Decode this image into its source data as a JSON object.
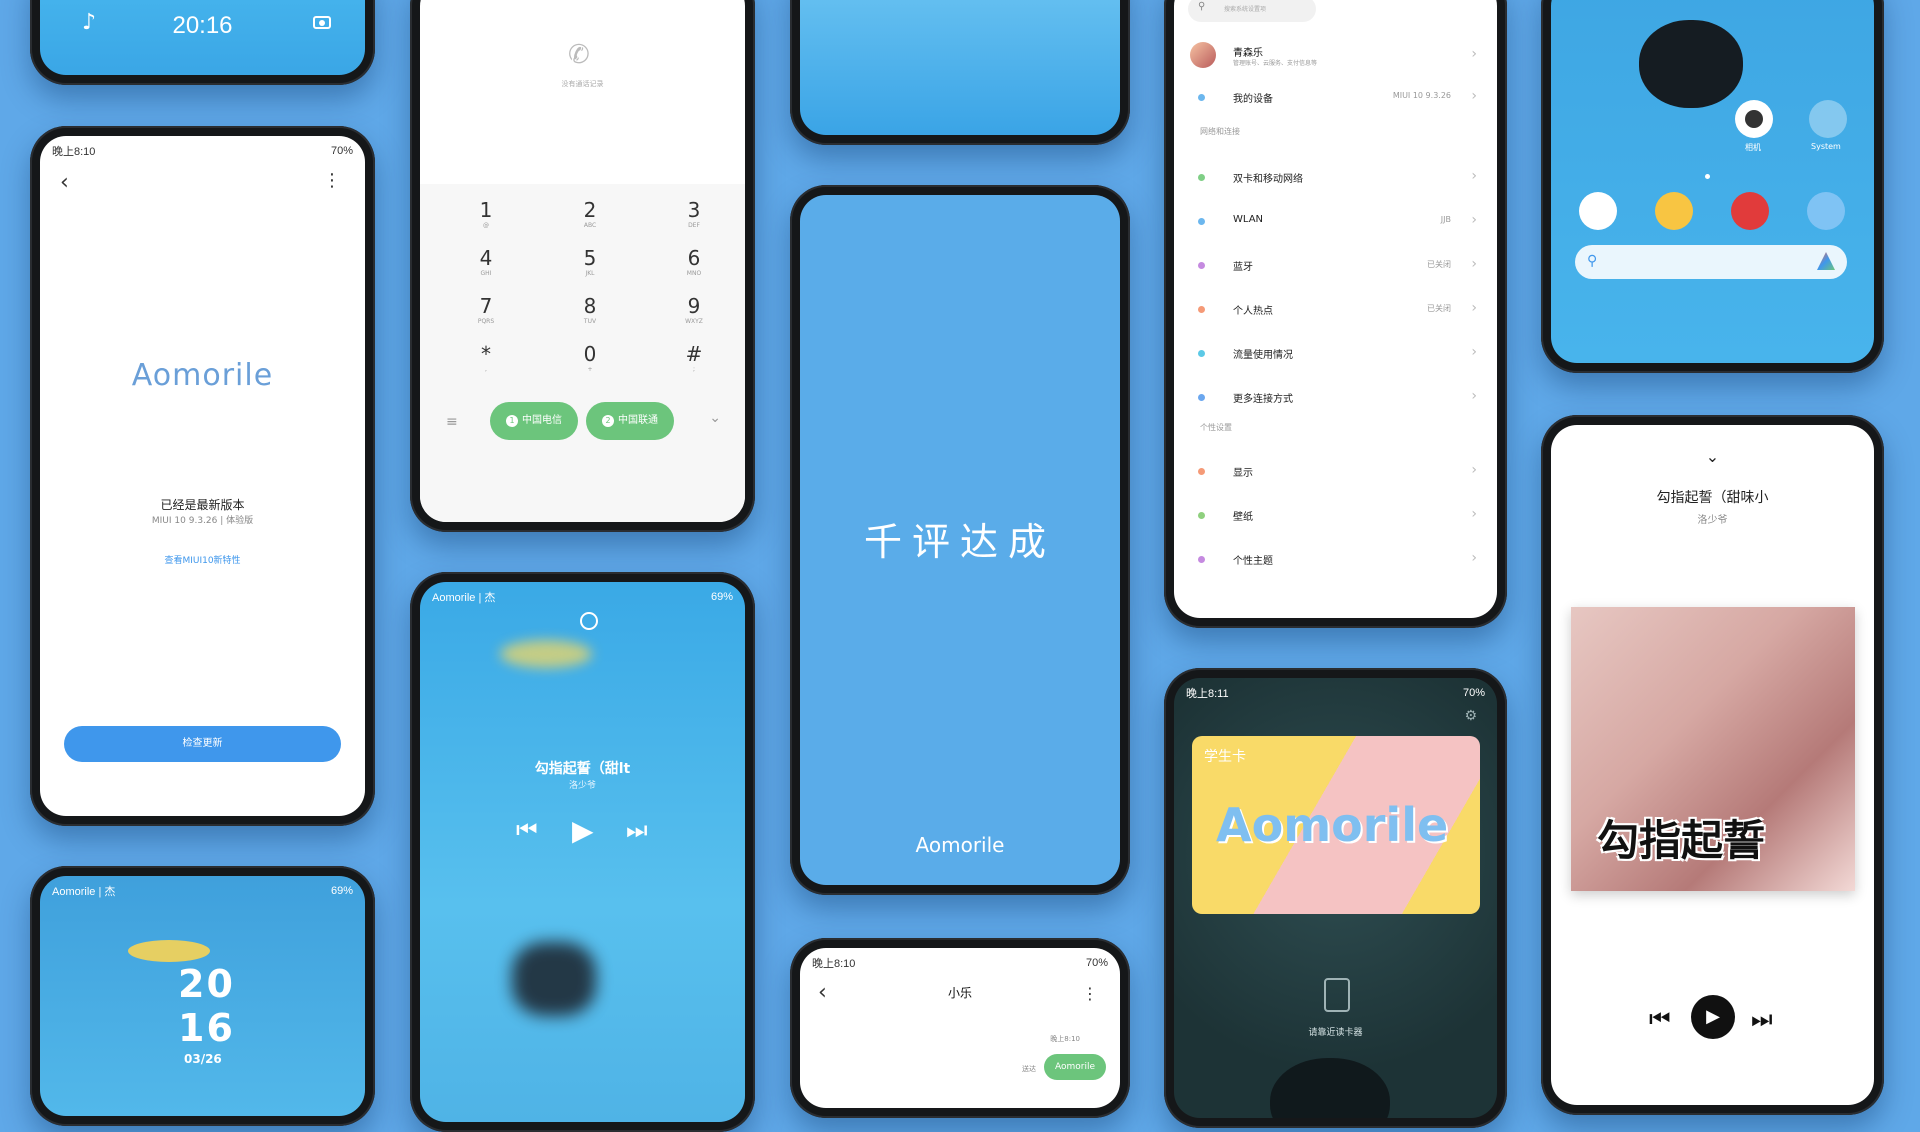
{
  "colors": {
    "background": "#5fa8e8",
    "accent": "#3f97ec",
    "dial_green": "#6cc57c"
  },
  "p1": {
    "time": "20:16",
    "music_icon": "music-note-icon",
    "camera_icon": "camera-icon"
  },
  "p2": {
    "status_time": "晚上8:10",
    "battery": "70%",
    "logo": "Aomorile",
    "title": "已经是最新版本",
    "version": "MIUI 10 9.3.26 | 体验版",
    "link": "查看MIUI10新特性",
    "button": "检查更新"
  },
  "p3": {
    "carrier": "Aomorile | 杰",
    "battery": "69%",
    "date_a": "20",
    "date_b": "16",
    "date": "03/26"
  },
  "p4": {
    "empty_text": "没有通话记录",
    "keys": [
      {
        "d": "1",
        "l": "@"
      },
      {
        "d": "2",
        "l": "ABC"
      },
      {
        "d": "3",
        "l": "DEF"
      },
      {
        "d": "4",
        "l": "GHI"
      },
      {
        "d": "5",
        "l": "JKL"
      },
      {
        "d": "6",
        "l": "MNO"
      },
      {
        "d": "7",
        "l": "PQRS"
      },
      {
        "d": "8",
        "l": "TUV"
      },
      {
        "d": "9",
        "l": "WXYZ"
      },
      {
        "d": "*",
        "l": ","
      },
      {
        "d": "0",
        "l": "+"
      },
      {
        "d": "#",
        "l": ";"
      }
    ],
    "sim1": "中国电信",
    "sim2": "中国联通",
    "sim1_num": "1",
    "sim2_num": "2"
  },
  "p5": {
    "carrier": "Aomorile | 杰",
    "battery": "69%",
    "song": "勾指起誓（甜lt",
    "artist": "洛少爷"
  },
  "p7": {
    "slogan": "千评达成",
    "logo": "Aomorile"
  },
  "p8": {
    "status_time": "晚上8:10",
    "battery": "70%",
    "title": "小乐",
    "msg_time": "晚上8:10",
    "sent_label": "送达",
    "bubble": "Aomorile"
  },
  "p9": {
    "search_placeholder": "搜索系统设置项",
    "profile_name": "青森乐",
    "profile_sub": "管理账号、云服务、支付信息等",
    "device": "我的设备",
    "device_val": "MIUI 10 9.3.26",
    "section1": "网络和连接",
    "items1": [
      {
        "label": "双卡和移动网络",
        "val": "",
        "color": "#7fcf86"
      },
      {
        "label": "WLAN",
        "val": "JJB",
        "color": "#6cb7ee"
      },
      {
        "label": "蓝牙",
        "val": "已关闭",
        "color": "#c58ae0"
      },
      {
        "label": "个人热点",
        "val": "已关闭",
        "color": "#f59a77"
      },
      {
        "label": "流量使用情况",
        "val": "",
        "color": "#5cc9e6"
      },
      {
        "label": "更多连接方式",
        "val": "",
        "color": "#6ba7ef"
      }
    ],
    "section2": "个性设置",
    "items2": [
      {
        "label": "显示",
        "val": "",
        "color": "#f59a77"
      },
      {
        "label": "壁纸",
        "val": "",
        "color": "#8fd07e"
      },
      {
        "label": "个性主题",
        "val": "",
        "color": "#c58ae0"
      }
    ]
  },
  "p10": {
    "status_time": "晚上8:11",
    "battery": "70%",
    "card_tag": "学生卡",
    "card_logo": "Aomorile",
    "hint": "请靠近读卡器"
  },
  "p11": {
    "app1": "相机",
    "app2": "System"
  },
  "p12": {
    "song": "勾指起誓（甜味小",
    "artist": "洛少爷",
    "cover_text": "勾指起誓"
  }
}
